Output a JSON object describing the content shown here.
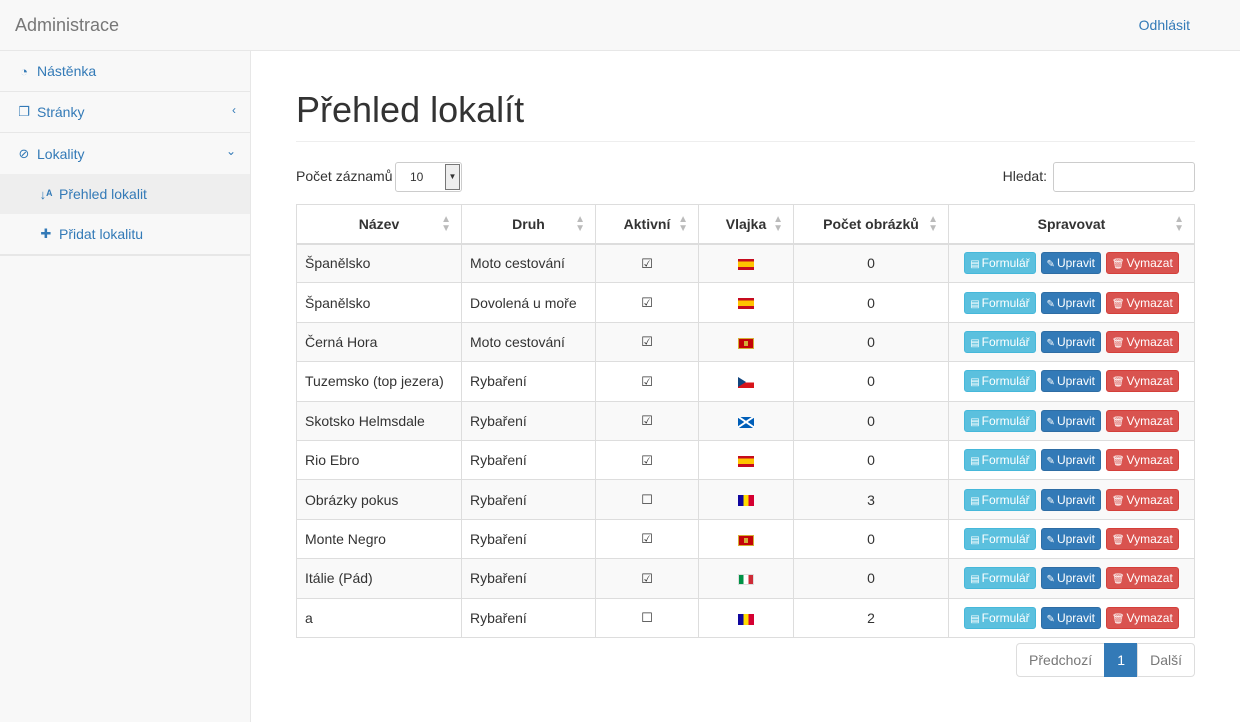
{
  "navbar": {
    "brand": "Administrace",
    "logout": "Odhlásit"
  },
  "sidebar": {
    "items": [
      {
        "label": "Nástěnka",
        "icon": "dashboard-icon"
      },
      {
        "label": "Stránky",
        "icon": "pages-icon",
        "arrow": "‹"
      },
      {
        "label": "Lokality",
        "icon": "compass-icon",
        "arrow": "⌄"
      }
    ],
    "subitems": [
      {
        "label": "Přehled lokalit",
        "icon": "sort-alpha-icon",
        "active": true
      },
      {
        "label": "Přidat lokalitu",
        "icon": "plus-icon"
      }
    ]
  },
  "main": {
    "title": "Přehled lokalít",
    "length_label": "Počet záznamů",
    "length_value": "10",
    "search_label": "Hledat:",
    "search_value": ""
  },
  "table": {
    "columns": [
      "Název",
      "Druh",
      "Aktivní",
      "Vlajka",
      "Počet obrázků",
      "Spravovat"
    ],
    "action_labels": {
      "form": "Formulář",
      "edit": "Upravit",
      "delete": "Vymazat"
    },
    "rows": [
      {
        "name": "Španělsko",
        "kind": "Moto cestování",
        "active": true,
        "flag": "es",
        "images": "0"
      },
      {
        "name": "Španělsko",
        "kind": "Dovolená u moře",
        "active": true,
        "flag": "es",
        "images": "0"
      },
      {
        "name": "Černá Hora",
        "kind": "Moto cestování",
        "active": true,
        "flag": "me",
        "images": "0"
      },
      {
        "name": "Tuzemsko (top jezera)",
        "kind": "Rybaření",
        "active": true,
        "flag": "cz",
        "images": "0"
      },
      {
        "name": "Skotsko Helmsdale",
        "kind": "Rybaření",
        "active": true,
        "flag": "sc",
        "images": "0"
      },
      {
        "name": "Rio Ebro",
        "kind": "Rybaření",
        "active": true,
        "flag": "es",
        "images": "0"
      },
      {
        "name": "Obrázky pokus",
        "kind": "Rybaření",
        "active": false,
        "flag": "ad",
        "images": "3"
      },
      {
        "name": "Monte Negro",
        "kind": "Rybaření",
        "active": true,
        "flag": "me",
        "images": "0"
      },
      {
        "name": "Itálie (Pád)",
        "kind": "Rybaření",
        "active": true,
        "flag": "it",
        "images": "0"
      },
      {
        "name": "a",
        "kind": "Rybaření",
        "active": false,
        "flag": "ad",
        "images": "2"
      }
    ]
  },
  "pagination": {
    "prev": "Předchozí",
    "current": "1",
    "next": "Další"
  }
}
